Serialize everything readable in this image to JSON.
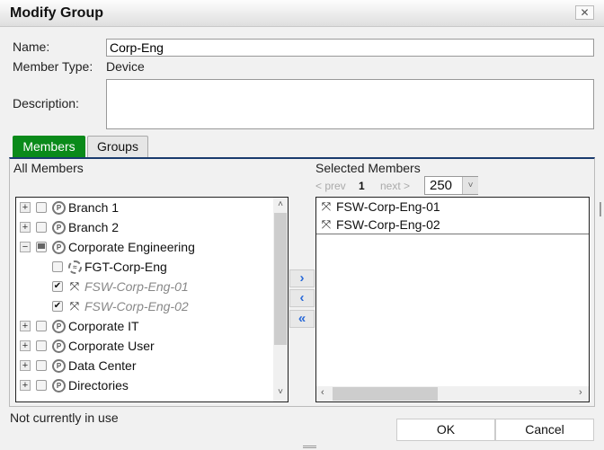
{
  "dialog": {
    "title": "Modify Group",
    "close_icon": "close-icon"
  },
  "form": {
    "name_label": "Name:",
    "name_value": "Corp-Eng",
    "member_type_label": "Member Type:",
    "member_type_value": "Device",
    "description_label": "Description:",
    "description_value": ""
  },
  "tabs": [
    {
      "label": "Members",
      "active": true
    },
    {
      "label": "Groups",
      "active": false
    }
  ],
  "all_members": {
    "label": "All Members",
    "tree": [
      {
        "label": "Branch 1",
        "expander": "+",
        "checked": false,
        "icon": "site-flag-icon",
        "level": 0
      },
      {
        "label": "Branch 2",
        "expander": "+",
        "checked": false,
        "icon": "site-flag-icon",
        "level": 0
      },
      {
        "label": "Corporate Engineering",
        "expander": "−",
        "checked": "partial",
        "icon": "site-flag-icon",
        "level": 0
      },
      {
        "label": "FGT-Corp-Eng",
        "checked": false,
        "icon": "firewall-icon",
        "level": 1
      },
      {
        "label": "FSW-Corp-Eng-01",
        "checked": true,
        "icon": "switch-icon",
        "level": 1,
        "disabled": true
      },
      {
        "label": "FSW-Corp-Eng-02",
        "checked": true,
        "icon": "switch-icon",
        "level": 1,
        "disabled": true
      },
      {
        "label": "Corporate IT",
        "expander": "+",
        "checked": false,
        "icon": "site-flag-icon",
        "level": 0
      },
      {
        "label": "Corporate User",
        "expander": "+",
        "checked": false,
        "icon": "site-flag-icon",
        "level": 0
      },
      {
        "label": "Data Center",
        "expander": "+",
        "checked": false,
        "icon": "site-flag-icon",
        "level": 0
      },
      {
        "label": "Directories",
        "expander": "+",
        "checked": false,
        "icon": "site-flag-icon",
        "level": 0
      }
    ]
  },
  "move_buttons": {
    "add": "›",
    "remove": "‹",
    "remove_all": "«"
  },
  "selected_members": {
    "label": "Selected Members",
    "pager": {
      "prev": "< prev",
      "page": "1",
      "next": "next >",
      "page_size": "250"
    },
    "items": [
      "FSW-Corp-Eng-01",
      "FSW-Corp-Eng-02"
    ]
  },
  "status": "Not currently in use",
  "buttons": {
    "ok": "OK",
    "cancel": "Cancel"
  },
  "colors": {
    "active_tab": "#0a8a1a",
    "tab_border": "#1a3b6e",
    "move_arrow": "#2a6ad8"
  }
}
